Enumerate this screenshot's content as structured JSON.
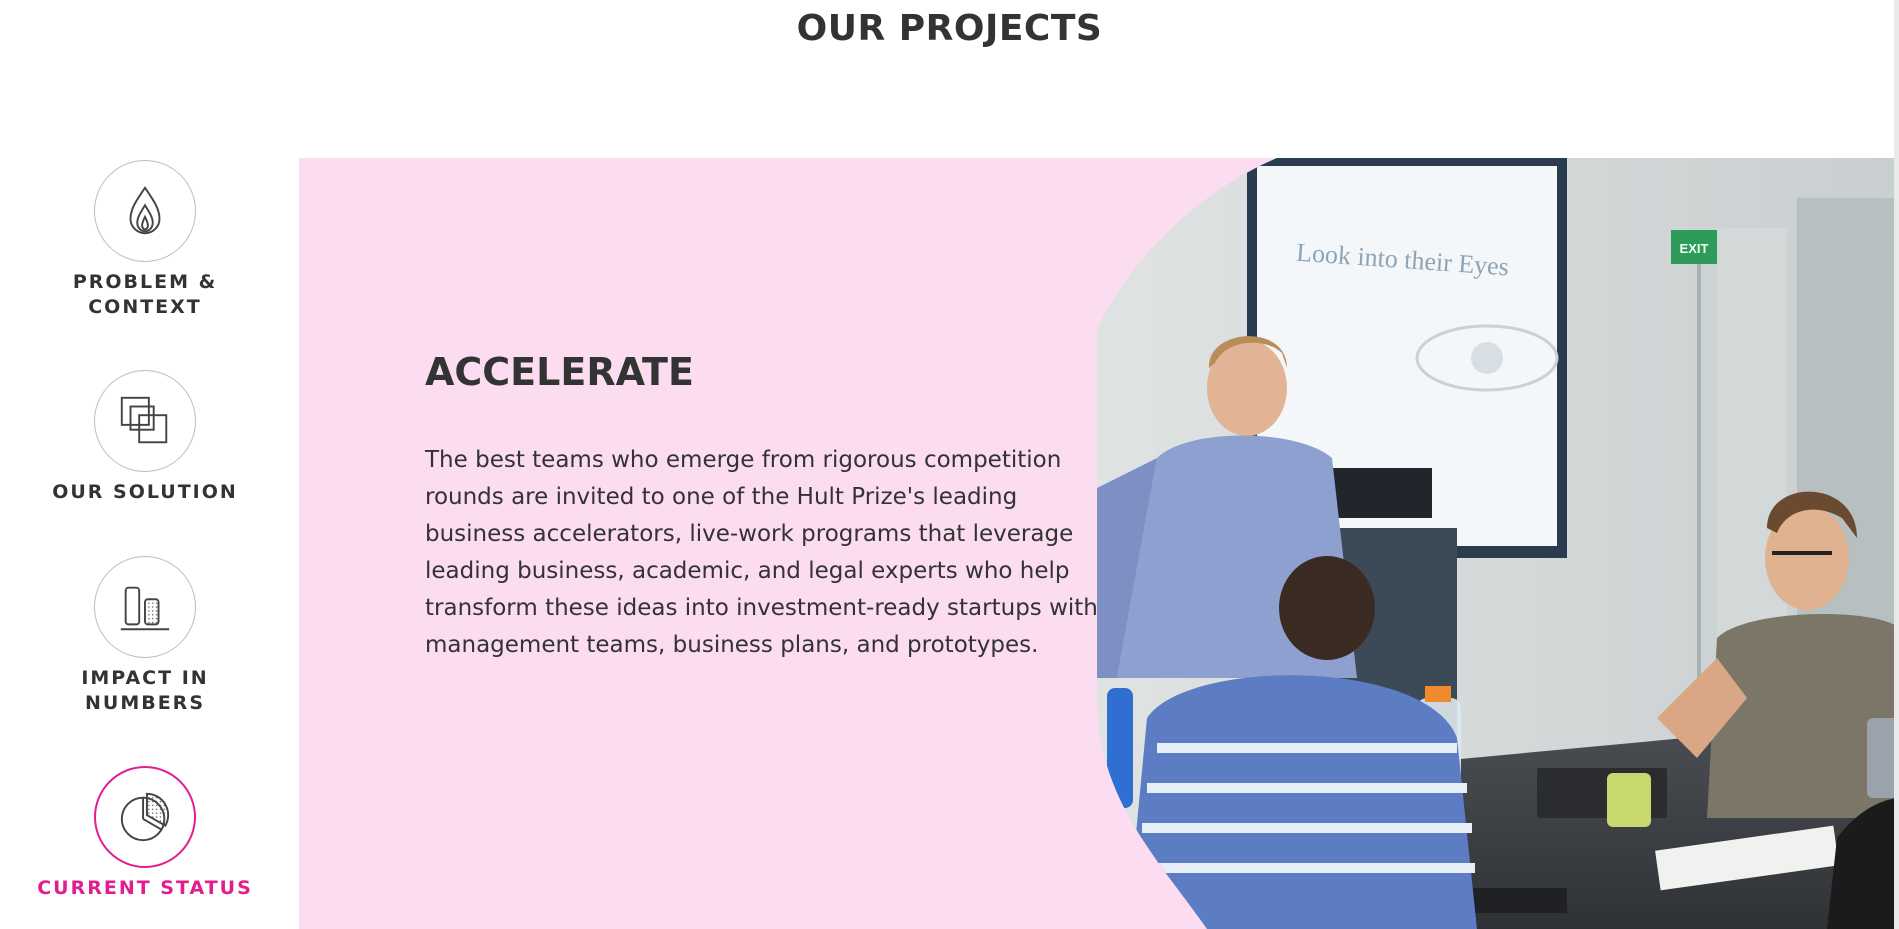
{
  "page": {
    "title": "OUR PROJECTS"
  },
  "nav": {
    "items": [
      {
        "label_line1": "PROBLEM &",
        "label_line2": "CONTEXT",
        "icon": "flame-icon",
        "active": false
      },
      {
        "label_line1": "OUR SOLUTION",
        "label_line2": "",
        "icon": "overlapping-squares-icon",
        "active": false
      },
      {
        "label_line1": "IMPACT IN",
        "label_line2": "NUMBERS",
        "icon": "bar-blocks-icon",
        "active": false
      },
      {
        "label_line1": "CURRENT STATUS",
        "label_line2": "",
        "icon": "pie-chart-icon",
        "active": true
      }
    ]
  },
  "panel": {
    "heading": "ACCELERATE",
    "body": "The best teams who emerge from rigorous competition rounds are invited to one of the Hult Prize's leading business accelerators, live-work programs that leverage leading business, academic, and legal experts who help transform these ideas into investment-ready startups with management teams, business plans, and prototypes.",
    "photo": {
      "screen_text": "Look into their Eyes",
      "exit_sign": "EXIT"
    }
  },
  "colors": {
    "accent": "#e21d8d",
    "panel_background": "#fbdcf0",
    "text": "#333333",
    "icon_border": "#bdbdbd"
  }
}
